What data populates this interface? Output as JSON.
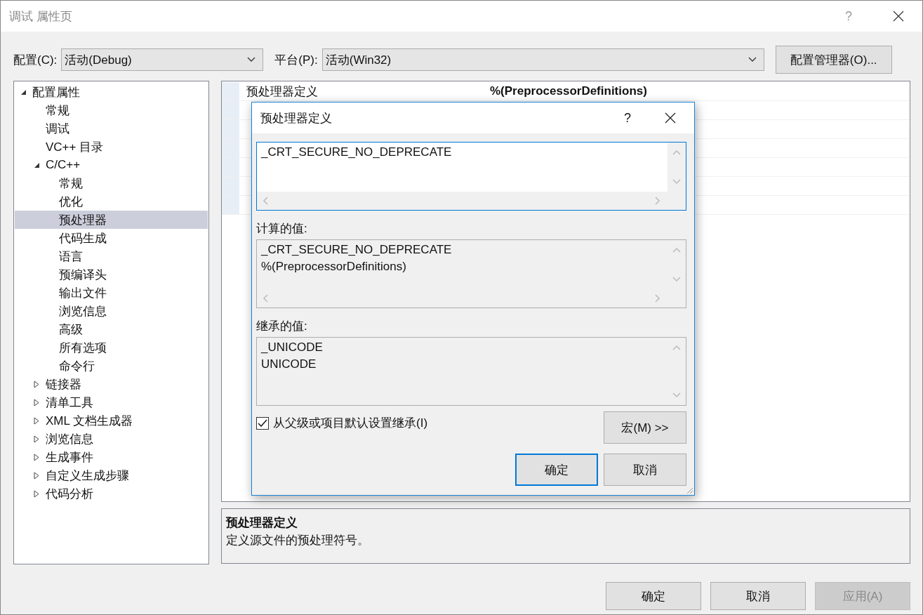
{
  "window": {
    "title": "调试 属性页",
    "help": "?"
  },
  "toolbar": {
    "config_label": "配置(C):",
    "config_value": "活动(Debug)",
    "platform_label": "平台(P):",
    "platform_value": "活动(Win32)",
    "manager_button": "配置管理器(O)..."
  },
  "tree": [
    {
      "label": "配置属性",
      "expanded": true,
      "selected": false,
      "children": [
        {
          "label": "常规",
          "selected": false
        },
        {
          "label": "调试",
          "selected": false
        },
        {
          "label": "VC++ 目录",
          "selected": false
        },
        {
          "label": "C/C++",
          "expanded": true,
          "selected": false,
          "children": [
            {
              "label": "常规",
              "selected": false
            },
            {
              "label": "优化",
              "selected": false
            },
            {
              "label": "预处理器",
              "selected": true
            },
            {
              "label": "代码生成",
              "selected": false
            },
            {
              "label": "语言",
              "selected": false
            },
            {
              "label": "预编译头",
              "selected": false
            },
            {
              "label": "输出文件",
              "selected": false
            },
            {
              "label": "浏览信息",
              "selected": false
            },
            {
              "label": "高级",
              "selected": false
            },
            {
              "label": "所有选项",
              "selected": false
            },
            {
              "label": "命令行",
              "selected": false
            }
          ]
        },
        {
          "label": "链接器",
          "expanded": false,
          "selected": false
        },
        {
          "label": "清单工具",
          "expanded": false,
          "selected": false
        },
        {
          "label": "XML 文档生成器",
          "expanded": false,
          "selected": false
        },
        {
          "label": "浏览信息",
          "expanded": false,
          "selected": false
        },
        {
          "label": "生成事件",
          "expanded": false,
          "selected": false
        },
        {
          "label": "自定义生成步骤",
          "expanded": false,
          "selected": false
        },
        {
          "label": "代码分析",
          "expanded": false,
          "selected": false
        }
      ]
    }
  ],
  "grid": {
    "rows": [
      {
        "name": "预处理器定义",
        "value": "%(PreprocessorDefinitions)"
      }
    ]
  },
  "description": {
    "title": "预处理器定义",
    "text": "定义源文件的预处理符号。"
  },
  "dialog": {
    "title": "预处理器定义",
    "help": "?",
    "boxes": [
      {
        "lines": [
          "_CRT_SECURE_NO_DEPRECATE"
        ],
        "readonly": false,
        "hscroll": true
      },
      {
        "label": "计算的值:",
        "lines": [
          "_CRT_SECURE_NO_DEPRECATE",
          "%(PreprocessorDefinitions)"
        ],
        "readonly": true,
        "hscroll": true
      },
      {
        "label": "继承的值:",
        "lines": [
          "_UNICODE",
          "UNICODE"
        ],
        "readonly": true,
        "hscroll": false
      }
    ],
    "inherit": {
      "label": "从父级或项目默认设置继承(I)",
      "checked": true
    },
    "macros_button": "宏(M) >>",
    "buttons": [
      {
        "label": "确定",
        "default": true
      },
      {
        "label": "取消",
        "default": false
      }
    ]
  },
  "buttons": [
    {
      "label": "确定",
      "disabled": false
    },
    {
      "label": "取消",
      "disabled": false
    },
    {
      "label": "应用(A)",
      "disabled": true
    }
  ]
}
